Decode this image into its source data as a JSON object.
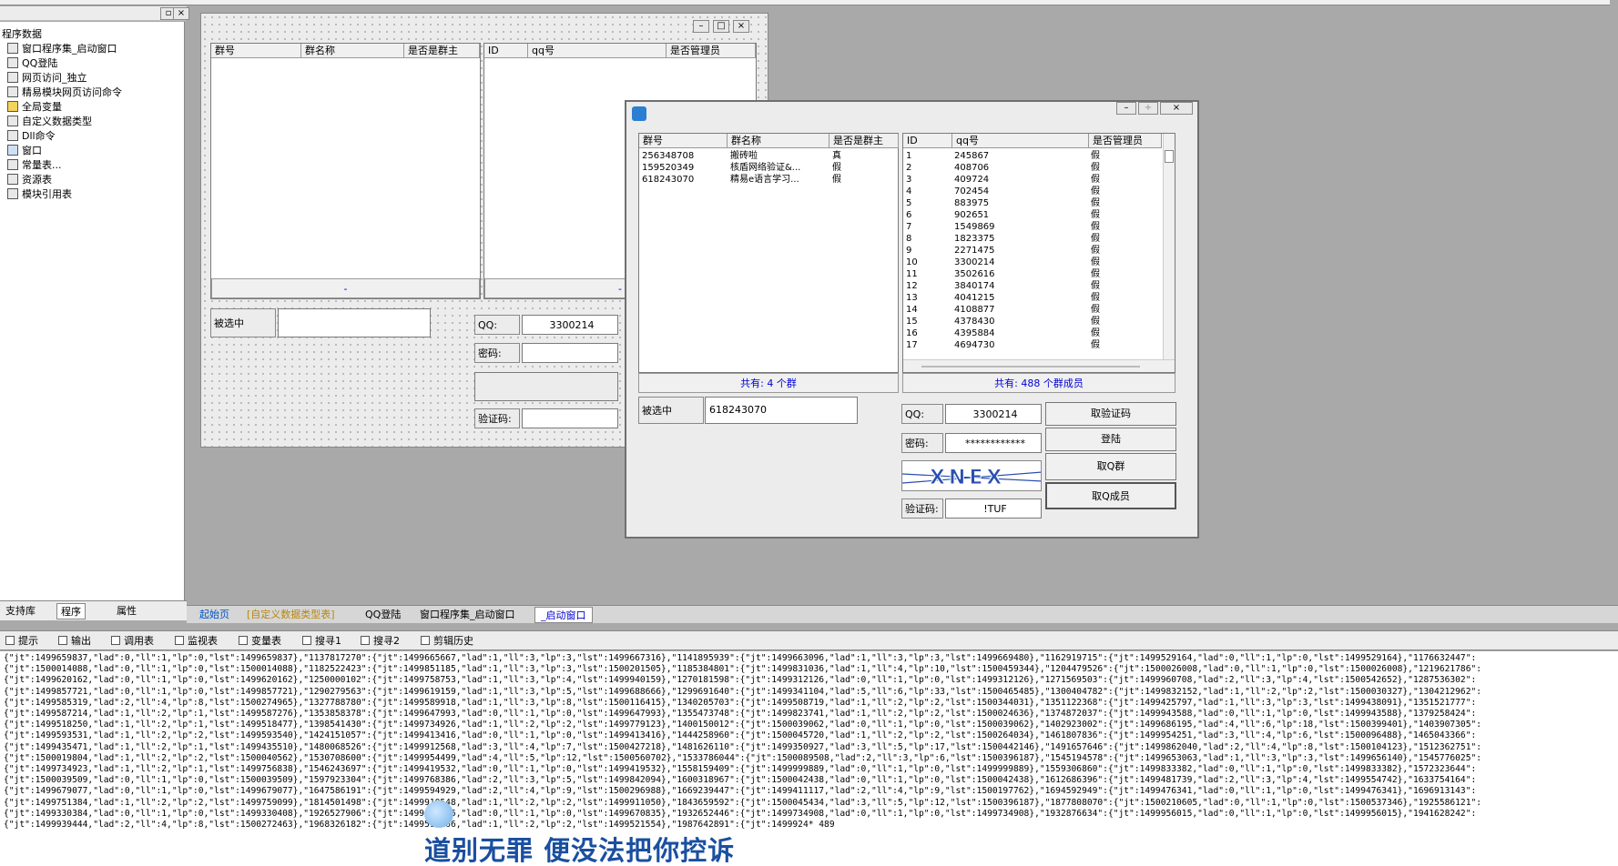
{
  "left_panel": {
    "title": "程序数据",
    "items": [
      {
        "label": "窗口程序集_启动窗口",
        "icon": "module-icon"
      },
      {
        "label": "QQ登陆",
        "icon": "module-icon"
      },
      {
        "label": "网页访问_独立",
        "icon": "module-icon"
      },
      {
        "label": "精易模块网页访问命令",
        "icon": "module-icon"
      },
      {
        "label": "全局变量",
        "icon": "variable-icon"
      },
      {
        "label": "自定义数据类型",
        "icon": "type-icon"
      },
      {
        "label": "Dll命令",
        "icon": "dll-icon"
      },
      {
        "label": "窗口",
        "icon": "window-icon"
      },
      {
        "label": "常量表...",
        "icon": "constant-icon"
      },
      {
        "label": "资源表",
        "icon": "resource-icon"
      },
      {
        "label": "模块引用表",
        "icon": "module-ref-icon"
      }
    ],
    "tabs": [
      "支持库",
      "程序",
      "属性"
    ]
  },
  "designer": {
    "group_headers": [
      "群号",
      "群名称",
      "是否是群主"
    ],
    "member_headers": [
      "ID",
      "qq号",
      "是否管理员"
    ],
    "group_footer": "-",
    "member_footer": "-",
    "selected_label": "被选中",
    "qq_label": "QQ:",
    "qq_value": "3300214",
    "password_label": "密码:",
    "captcha_label": "验证码:"
  },
  "runtime": {
    "group_headers": [
      "群号",
      "群名称",
      "是否是群主"
    ],
    "groups": [
      [
        "256348708",
        "搬砖啦",
        "真"
      ],
      [
        "159520349",
        "核盾网络验证&...",
        "假"
      ],
      [
        "618243070",
        "精易e语言学习...",
        "假"
      ]
    ],
    "member_headers": [
      "ID",
      "qq号",
      "是否管理员"
    ],
    "members": [
      [
        "1",
        "245867",
        "假"
      ],
      [
        "2",
        "408706",
        "假"
      ],
      [
        "3",
        "409724",
        "假"
      ],
      [
        "4",
        "702454",
        "假"
      ],
      [
        "5",
        "883975",
        "假"
      ],
      [
        "6",
        "902651",
        "假"
      ],
      [
        "7",
        "1549869",
        "假"
      ],
      [
        "8",
        "1823375",
        "假"
      ],
      [
        "9",
        "2271475",
        "假"
      ],
      [
        "10",
        "3300214",
        "假"
      ],
      [
        "11",
        "3502616",
        "假"
      ],
      [
        "12",
        "3840174",
        "假"
      ],
      [
        "13",
        "4041215",
        "假"
      ],
      [
        "14",
        "4108877",
        "假"
      ],
      [
        "15",
        "4378430",
        "假"
      ],
      [
        "16",
        "4395884",
        "假"
      ],
      [
        "17",
        "4694730",
        "假"
      ]
    ],
    "group_count": "共有:  4  个群",
    "member_count": "共有:  488  个群成员",
    "selected_label": "被选中",
    "selected_value": "618243070",
    "qq_label": "QQ:",
    "qq_value": "3300214",
    "password_label": "密码:",
    "password_value": "************",
    "captcha_label": "验证码:",
    "captcha_value": "!TUF",
    "captcha_image_text": "XNEX",
    "buttons": [
      "取验证码",
      "登陆",
      "取Q群",
      "取Q成员"
    ]
  },
  "doc_tabs": [
    "起始页",
    "[自定义数据类型表]",
    "QQ登陆",
    "窗口程序集_启动窗口",
    "_启动窗口"
  ],
  "bottom_tabs": [
    "提示",
    "输出",
    "调用表",
    "监视表",
    "变量表",
    "搜寻1",
    "搜寻2",
    "剪辑历史"
  ],
  "output_lines": [
    "{\"jt\":1499659837,\"lad\":0,\"ll\":1,\"lp\":0,\"lst\":1499659837},\"1137817270\":{\"jt\":1499665667,\"lad\":1,\"ll\":3,\"lp\":3,\"lst\":1499667316},\"1141895939\":{\"jt\":1499663096,\"lad\":1,\"ll\":3,\"lp\":3,\"lst\":1499669480},\"1162919715\":{\"jt\":1499529164,\"lad\":0,\"ll\":1,\"lp\":0,\"lst\":1499529164},\"1176632447\":",
    "{\"jt\":1500014088,\"lad\":0,\"ll\":1,\"lp\":0,\"lst\":1500014088},\"1182522423\":{\"jt\":1499851185,\"lad\":1,\"ll\":3,\"lp\":3,\"lst\":1500201505},\"1185384801\":{\"jt\":1499831036,\"lad\":1,\"ll\":4,\"lp\":10,\"lst\":1500459344},\"1204479526\":{\"jt\":1500026008,\"lad\":0,\"ll\":1,\"lp\":0,\"lst\":1500026008},\"1219621786\":",
    "{\"jt\":1499620162,\"lad\":0,\"ll\":1,\"lp\":0,\"lst\":1499620162},\"1250000102\":{\"jt\":1499758753,\"lad\":1,\"ll\":3,\"lp\":4,\"lst\":1499940159},\"1270181598\":{\"jt\":1499312126,\"lad\":0,\"ll\":1,\"lp\":0,\"lst\":1499312126},\"1271569503\":{\"jt\":1499960708,\"lad\":2,\"ll\":3,\"lp\":4,\"lst\":1500542652},\"1287536302\":",
    "{\"jt\":1499857721,\"lad\":0,\"ll\":1,\"lp\":0,\"lst\":1499857721},\"1290279563\":{\"jt\":1499619159,\"lad\":1,\"ll\":3,\"lp\":5,\"lst\":1499688666},\"1299691640\":{\"jt\":1499341104,\"lad\":5,\"ll\":6,\"lp\":33,\"lst\":1500465485},\"1300404782\":{\"jt\":1499832152,\"lad\":1,\"ll\":2,\"lp\":2,\"lst\":1500030327},\"1304212962\":",
    "{\"jt\":1499585319,\"lad\":2,\"ll\":4,\"lp\":8,\"lst\":1500274965},\"1327788780\":{\"jt\":1499589918,\"lad\":1,\"ll\":3,\"lp\":8,\"lst\":1500116415},\"1340205703\":{\"jt\":1499508719,\"lad\":1,\"ll\":2,\"lp\":2,\"lst\":1500344031},\"1351122368\":{\"jt\":1499425797,\"lad\":1,\"ll\":3,\"lp\":3,\"lst\":1499438091},\"1351521777\":",
    "{\"jt\":1499587214,\"lad\":1,\"ll\":2,\"lp\":1,\"lst\":1499587276},\"1353858378\":{\"jt\":1499647993,\"lad\":0,\"ll\":1,\"lp\":0,\"lst\":1499647993},\"1355473748\":{\"jt\":1499823741,\"lad\":1,\"ll\":2,\"lp\":2,\"lst\":1500024636},\"1374872037\":{\"jt\":1499943588,\"lad\":0,\"ll\":1,\"lp\":0,\"lst\":1499943588},\"1379258424\":",
    "{\"jt\":1499518250,\"lad\":1,\"ll\":2,\"lp\":1,\"lst\":1499518477},\"1398541430\":{\"jt\":1499734926,\"lad\":1,\"ll\":2,\"lp\":2,\"lst\":1499779123},\"1400150012\":{\"jt\":1500039062,\"lad\":0,\"ll\":1,\"lp\":0,\"lst\":1500039062},\"1402923002\":{\"jt\":1499686195,\"lad\":4,\"ll\":6,\"lp\":18,\"lst\":1500399401},\"1403907305\":",
    "{\"jt\":1499593531,\"lad\":1,\"ll\":2,\"lp\":2,\"lst\":1499593540},\"1424151057\":{\"jt\":1499413416,\"lad\":0,\"ll\":1,\"lp\":0,\"lst\":1499413416},\"1444258960\":{\"jt\":1500045720,\"lad\":1,\"ll\":2,\"lp\":2,\"lst\":1500264034},\"1461807836\":{\"jt\":1499954251,\"lad\":3,\"ll\":4,\"lp\":6,\"lst\":1500096488},\"1465043366\":",
    "{\"jt\":1499435471,\"lad\":1,\"ll\":2,\"lp\":1,\"lst\":1499435510},\"1480068526\":{\"jt\":1499912568,\"lad\":3,\"ll\":4,\"lp\":7,\"lst\":1500427218},\"1481626110\":{\"jt\":1499350927,\"lad\":3,\"ll\":5,\"lp\":17,\"lst\":1500442146},\"1491657646\":{\"jt\":1499862040,\"lad\":2,\"ll\":4,\"lp\":8,\"lst\":1500104123},\"1512362751\":",
    "{\"jt\":1500019804,\"lad\":1,\"ll\":2,\"lp\":2,\"lst\":1500040562},\"1530708600\":{\"jt\":1499954499,\"lad\":4,\"ll\":5,\"lp\":12,\"lst\":1500560702},\"1533786044\":{\"jt\":1500089508,\"lad\":2,\"ll\":3,\"lp\":6,\"lst\":1500396187},\"1545194578\":{\"jt\":1499653063,\"lad\":1,\"ll\":3,\"lp\":3,\"lst\":1499656140},\"1545776025\":",
    "{\"jt\":1499734923,\"lad\":1,\"ll\":2,\"lp\":1,\"lst\":1499756838},\"1546243697\":{\"jt\":1499419532,\"lad\":0,\"ll\":1,\"lp\":0,\"lst\":1499419532},\"1558159409\":{\"jt\":1499999889,\"lad\":0,\"ll\":1,\"lp\":0,\"lst\":1499999889},\"1559306860\":{\"jt\":1499833382,\"lad\":0,\"ll\":1,\"lp\":0,\"lst\":1499833382},\"1572323644\":",
    "{\"jt\":1500039509,\"lad\":0,\"ll\":1,\"lp\":0,\"lst\":1500039509},\"1597923304\":{\"jt\":1499768386,\"lad\":2,\"ll\":3,\"lp\":5,\"lst\":1499842094},\"1600318967\":{\"jt\":1500042438,\"lad\":0,\"ll\":1,\"lp\":0,\"lst\":1500042438},\"1612686396\":{\"jt\":1499481739,\"lad\":2,\"ll\":3,\"lp\":4,\"lst\":1499554742},\"1633754164\":",
    "{\"jt\":1499679077,\"lad\":0,\"ll\":1,\"lp\":0,\"lst\":1499679077},\"1647586191\":{\"jt\":1499594929,\"lad\":2,\"ll\":4,\"lp\":9,\"lst\":1500296988},\"1669239447\":{\"jt\":1499411117,\"lad\":2,\"ll\":4,\"lp\":9,\"lst\":1500197762},\"1694592949\":{\"jt\":1499476341,\"lad\":0,\"ll\":1,\"lp\":0,\"lst\":1499476341},\"1696913143\":",
    "{\"jt\":1499751384,\"lad\":1,\"ll\":2,\"lp\":2,\"lst\":1499759099},\"1814501498\":{\"jt\":1499910548,\"lad\":1,\"ll\":2,\"lp\":2,\"lst\":1499911050},\"1843659592\":{\"jt\":1500045434,\"lad\":3,\"ll\":5,\"lp\":12,\"lst\":1500396187},\"1877808070\":{\"jt\":1500210605,\"lad\":0,\"ll\":1,\"lp\":0,\"lst\":1500537346},\"1925586121\":",
    "{\"jt\":1499330384,\"lad\":0,\"ll\":1,\"lp\":0,\"lst\":1499330408},\"1926527906\":{\"jt\":1499670835,\"lad\":0,\"ll\":1,\"lp\":0,\"lst\":1499670835},\"1932652446\":{\"jt\":1499734908,\"lad\":0,\"ll\":1,\"lp\":0,\"lst\":1499734908},\"1932876634\":{\"jt\":1499956015,\"lad\":0,\"ll\":1,\"lp\":0,\"lst\":1499956015},\"1941628242\":",
    "{\"jt\":1499939444,\"lad\":2,\"ll\":4,\"lp\":8,\"lst\":1500272463},\"1968326182\":{\"jt\":1499519166,\"lad\":1,\"ll\":2,\"lp\":2,\"lst\":1499521554},\"1987642891\":{\"jt\":1499924* 489"
  ],
  "overlay_text": "道别无罪  便没法把你控诉"
}
